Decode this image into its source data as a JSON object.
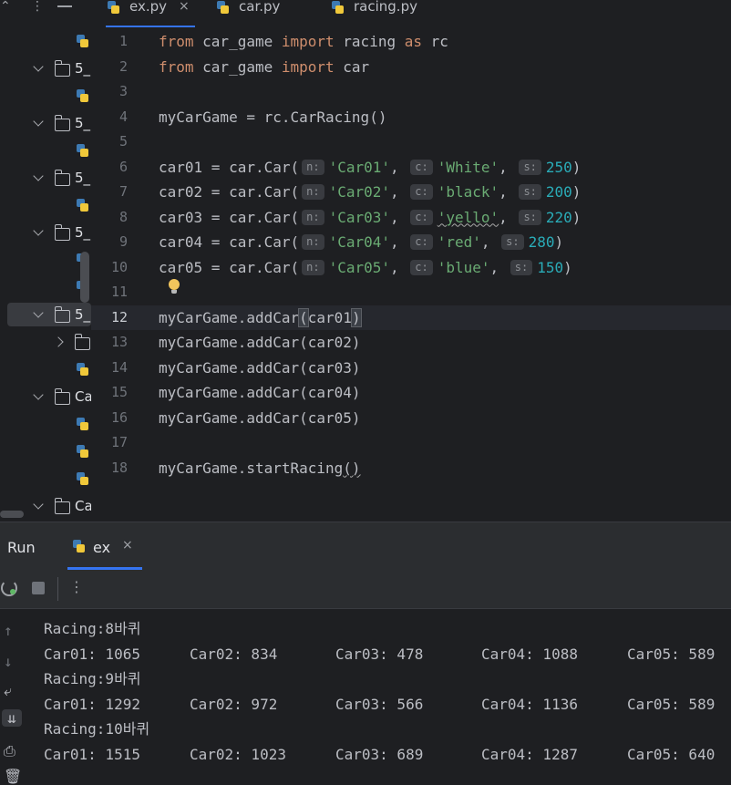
{
  "tabs": [
    {
      "label": "ex.py",
      "active": true,
      "close": "×"
    },
    {
      "label": "car.py",
      "active": false
    },
    {
      "label": "racing.py",
      "active": false
    }
  ],
  "sidebar": {
    "items": [
      {
        "type": "file"
      },
      {
        "type": "folder",
        "label": "5_",
        "expanded": true
      },
      {
        "type": "file"
      },
      {
        "type": "folder",
        "label": "5_",
        "expanded": true
      },
      {
        "type": "file"
      },
      {
        "type": "folder",
        "label": "5_",
        "expanded": true
      },
      {
        "type": "file"
      },
      {
        "type": "folder",
        "label": "5_",
        "expanded": true
      },
      {
        "type": "file"
      },
      {
        "type": "file"
      },
      {
        "type": "folder",
        "label": "5_",
        "expanded": true,
        "selected": true
      },
      {
        "type": "folder",
        "label": "",
        "expanded": false
      },
      {
        "type": "file"
      },
      {
        "type": "folder",
        "label": "Ca",
        "expanded": true
      },
      {
        "type": "file"
      },
      {
        "type": "file"
      },
      {
        "type": "file"
      },
      {
        "type": "folder",
        "label": "Ca",
        "expanded": true
      }
    ]
  },
  "editor": {
    "current_line": 12,
    "lines": [
      {
        "n": "1",
        "tokens": [
          [
            "kw",
            "from"
          ],
          [
            "t",
            " car_game "
          ],
          [
            "kw",
            "import"
          ],
          [
            "t",
            " racing "
          ],
          [
            "kw",
            "as"
          ],
          [
            "t",
            " rc"
          ]
        ]
      },
      {
        "n": "2",
        "tokens": [
          [
            "kw",
            "from"
          ],
          [
            "t",
            " car_game "
          ],
          [
            "kw",
            "import"
          ],
          [
            "t",
            " car"
          ]
        ]
      },
      {
        "n": "3",
        "tokens": []
      },
      {
        "n": "4",
        "tokens": [
          [
            "t",
            "myCarGame = rc.CarRacing()"
          ]
        ]
      },
      {
        "n": "5",
        "tokens": []
      },
      {
        "n": "6",
        "tokens": [
          [
            "t",
            "car01 = car.Car("
          ],
          [
            "h",
            "n:"
          ],
          [
            "s",
            "'Car01'"
          ],
          [
            "t",
            ", "
          ],
          [
            "h",
            "c:"
          ],
          [
            "s",
            "'White'"
          ],
          [
            "t",
            ", "
          ],
          [
            "h",
            "s:"
          ],
          [
            "num",
            "250"
          ],
          [
            "t",
            ")"
          ]
        ]
      },
      {
        "n": "7",
        "tokens": [
          [
            "t",
            "car02 = car.Car("
          ],
          [
            "h",
            "n:"
          ],
          [
            "s",
            "'Car02'"
          ],
          [
            "t",
            ", "
          ],
          [
            "h",
            "c:"
          ],
          [
            "s",
            "'black'"
          ],
          [
            "t",
            ", "
          ],
          [
            "h",
            "s:"
          ],
          [
            "num",
            "200"
          ],
          [
            "t",
            ")"
          ]
        ]
      },
      {
        "n": "8",
        "tokens": [
          [
            "t",
            "car03 = car.Car("
          ],
          [
            "h",
            "n:"
          ],
          [
            "s",
            "'Car03'"
          ],
          [
            "t",
            ", "
          ],
          [
            "h",
            "c:"
          ],
          [
            "sw",
            "'yello'"
          ],
          [
            "t",
            ", "
          ],
          [
            "h",
            "s:"
          ],
          [
            "num",
            "220"
          ],
          [
            "t",
            ")"
          ]
        ]
      },
      {
        "n": "9",
        "tokens": [
          [
            "t",
            "car04 = car.Car("
          ],
          [
            "h",
            "n:"
          ],
          [
            "s",
            "'Car04'"
          ],
          [
            "t",
            ", "
          ],
          [
            "h",
            "c:"
          ],
          [
            "s",
            "'red'"
          ],
          [
            "t",
            ", "
          ],
          [
            "h",
            "s:"
          ],
          [
            "num",
            "280"
          ],
          [
            "t",
            ")"
          ]
        ]
      },
      {
        "n": "10",
        "tokens": [
          [
            "t",
            "car05 = car.Car("
          ],
          [
            "h",
            "n:"
          ],
          [
            "s",
            "'Car05'"
          ],
          [
            "t",
            ", "
          ],
          [
            "h",
            "c:"
          ],
          [
            "s",
            "'blue'"
          ],
          [
            "t",
            ", "
          ],
          [
            "h",
            "s:"
          ],
          [
            "num",
            "150"
          ],
          [
            "t",
            ")"
          ]
        ]
      },
      {
        "n": "11",
        "tokens": []
      },
      {
        "n": "12",
        "tokens": [
          [
            "t",
            "myCarGame.addCar"
          ],
          [
            "ph",
            "("
          ],
          [
            "t",
            "car01"
          ],
          [
            "ph",
            ")"
          ]
        ]
      },
      {
        "n": "13",
        "tokens": [
          [
            "t",
            "myCarGame.addCar(car02)"
          ]
        ]
      },
      {
        "n": "14",
        "tokens": [
          [
            "t",
            "myCarGame.addCar(car03)"
          ]
        ]
      },
      {
        "n": "15",
        "tokens": [
          [
            "t",
            "myCarGame.addCar(car04)"
          ]
        ]
      },
      {
        "n": "16",
        "tokens": [
          [
            "t",
            "myCarGame.addCar(car05)"
          ]
        ]
      },
      {
        "n": "17",
        "tokens": []
      },
      {
        "n": "18",
        "tokens": [
          [
            "t",
            "myCarGame.startRacing"
          ],
          [
            "tw",
            "()"
          ]
        ]
      }
    ]
  },
  "run": {
    "title": "Run",
    "tab_label": "ex",
    "tab_close": "×",
    "menu_glyph": "⋮",
    "output": [
      {
        "kind": "header",
        "text": "Racing:8바퀴"
      },
      {
        "kind": "row",
        "cells": [
          "Car01: 1065",
          "Car02: 834",
          "Car03: 478",
          "Car04: 1088",
          "Car05: 589"
        ]
      },
      {
        "kind": "header",
        "text": "Racing:9바퀴"
      },
      {
        "kind": "row",
        "cells": [
          "Car01: 1292",
          "Car02: 972",
          "Car03: 566",
          "Car04: 1136",
          "Car05: 589"
        ]
      },
      {
        "kind": "header",
        "text": "Racing:10바퀴"
      },
      {
        "kind": "row",
        "cells": [
          "Car01: 1515",
          "Car02: 1023",
          "Car03: 689",
          "Car04: 1287",
          "Car05: 640"
        ]
      }
    ]
  },
  "colors": {
    "keyword": "#cf8e6d",
    "string": "#6aab73",
    "number": "#2aacb8",
    "accent": "#3574f0"
  }
}
